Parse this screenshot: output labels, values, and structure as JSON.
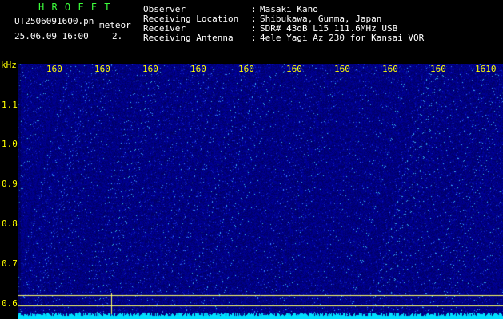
{
  "header": {
    "title": "H R O F F T",
    "file": "UT2506091600.pn",
    "mode": "meteor",
    "datetime": "25.06.09 16:00",
    "scale_mark": "2.",
    "fields": [
      {
        "label": "Observer",
        "sep": ":",
        "value": "Masaki Kano"
      },
      {
        "label": "Receiving Location",
        "sep": ":",
        "value": "Shibukawa, Gunma, Japan"
      },
      {
        "label": "Receiver",
        "sep": ":",
        "value": "SDR# 43dB L15 111.6MHz USB"
      },
      {
        "label": "Receiving Antenna",
        "sep": ":",
        "value": "4ele Yagi Az 230 for Kansai VOR"
      }
    ]
  },
  "axes": {
    "y_unit": "kHz",
    "y_ticks": [
      "1.1",
      "1.0",
      "0.9",
      "0.8",
      "0.7",
      "0.6"
    ],
    "x_ticks": [
      "160",
      "160",
      "160",
      "160",
      "160",
      "160",
      "160",
      "160",
      "160",
      "1610"
    ]
  },
  "colors": {
    "background": "#000000",
    "waterfall_base": "#00007a",
    "noise_floor": "#00e0ff",
    "guide_lines": "#ffff66",
    "header_green": "#3cff3c",
    "header_white": "#ffffff",
    "axis_yellow": "#ffff00"
  }
}
